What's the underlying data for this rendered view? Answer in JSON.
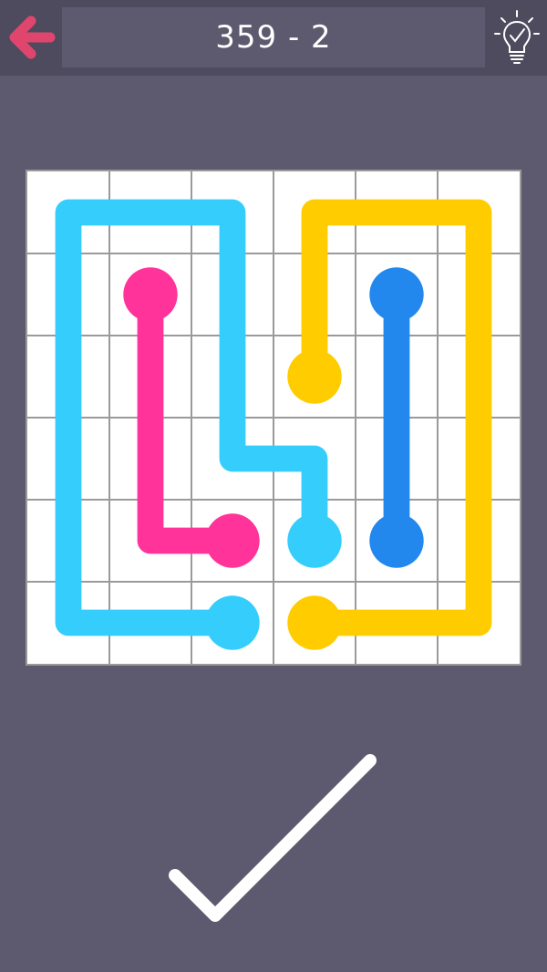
{
  "header": {
    "level_title": "359 - 2",
    "back_icon": "back-arrow-icon",
    "hint_icon": "lightbulb-hint-icon"
  },
  "colors": {
    "background": "#5d596e",
    "header": "#4f4b5f",
    "back_arrow": "#e0456e",
    "grid_line": "#9a9a9a",
    "cell": "#ffffff",
    "complete_check": "#ffffff"
  },
  "board": {
    "rows": 6,
    "cols": 6,
    "flows": [
      {
        "name": "cyan",
        "color": "#35cdfb",
        "endpoints": [
          [
            5,
            2
          ],
          [
            4,
            3
          ]
        ],
        "path": [
          [
            5,
            2
          ],
          [
            5,
            0
          ],
          [
            0,
            0
          ],
          [
            0,
            2
          ],
          [
            3,
            2
          ],
          [
            3,
            3
          ],
          [
            4,
            3
          ]
        ]
      },
      {
        "name": "pink",
        "color": "#ff3399",
        "endpoints": [
          [
            1,
            1
          ],
          [
            4,
            2
          ]
        ],
        "path": [
          [
            1,
            1
          ],
          [
            4,
            1
          ],
          [
            4,
            2
          ]
        ]
      },
      {
        "name": "yellow",
        "color": "#ffcc00",
        "endpoints": [
          [
            2,
            3
          ],
          [
            5,
            3
          ]
        ],
        "path": [
          [
            2,
            3
          ],
          [
            0,
            3
          ],
          [
            0,
            5
          ],
          [
            5,
            5
          ],
          [
            5,
            3
          ]
        ]
      },
      {
        "name": "blue",
        "color": "#2288ee",
        "endpoints": [
          [
            1,
            4
          ],
          [
            4,
            4
          ]
        ],
        "path": [
          [
            1,
            4
          ],
          [
            4,
            4
          ]
        ]
      }
    ]
  },
  "footer": {
    "complete_icon": "checkmark-icon"
  }
}
